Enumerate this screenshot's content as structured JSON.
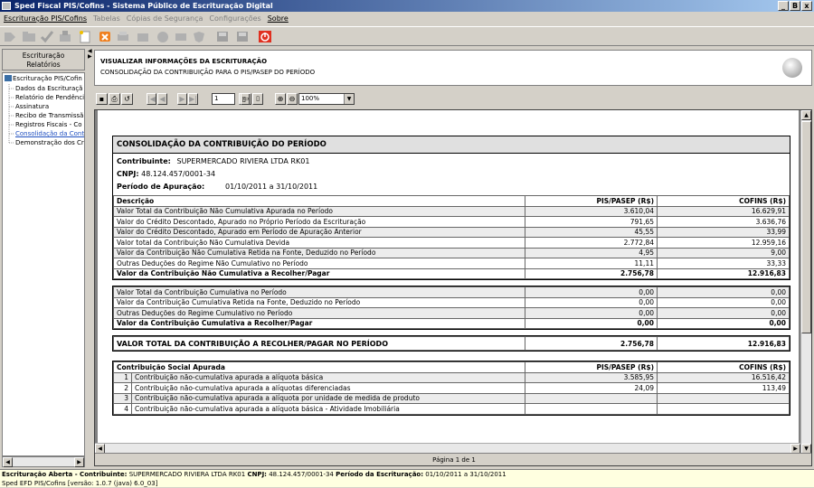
{
  "window": {
    "title": "Sped Fiscal PIS/Cofins - Sistema Público de Escrituração Digital",
    "minimize": "_",
    "maximize": "B",
    "close": "x"
  },
  "menu": [
    "Escrituração PIS/Cofins",
    "Tabelas",
    "Cópias de Segurança",
    "Configurações",
    "Sobre"
  ],
  "nav": {
    "title_line1": "Escrituração",
    "title_line2": "Relatórios",
    "tree": [
      {
        "label": "Escrituração PIS/Cofin",
        "root": true
      },
      {
        "label": "Dados da Escrituraçã"
      },
      {
        "label": "Relatório de Pendência"
      },
      {
        "label": "Assinatura"
      },
      {
        "label": "Recibo de Transmissã"
      },
      {
        "label": "Registros Fiscais - Co"
      },
      {
        "label": "Consolidação da Conti",
        "link": true
      },
      {
        "label": "Demonstração dos Cré"
      }
    ]
  },
  "viewheader": {
    "title": "VISUALIZAR INFORMAÇÕES DA ESCRITURAÇÃO",
    "subtitle": "CONSOLIDAÇÃO DA CONTRIBUIÇÃO PARA O PIS/PASEP DO PERÍODO"
  },
  "reportbar": {
    "page": "1",
    "zoom": "100%"
  },
  "report": {
    "title": "CONSOLIDAÇÃO DA CONTRIBUIÇÃO DO PERÍODO",
    "contrib_label": "Contribuinte:",
    "contrib_value": "SUPERMERCADO RIVIERA LTDA RK01",
    "cnpj_label": "CNPJ:",
    "cnpj_value": "48.124.457/0001-34",
    "periodo_label": "Período de Apuração:",
    "periodo_value": "01/10/2011 a 31/10/2011",
    "col_desc": "Descrição",
    "col_pis": "PIS/PASEP (R$)",
    "col_cofins": "COFINS (R$)",
    "rows1": [
      {
        "d": "Valor Total da Contribuição Não Cumulativa Apurada no Período",
        "p": "3.610,04",
        "c": "16.629,91"
      },
      {
        "d": "Valor do Crédito Descontado, Apurado no Próprio Período da Escrituração",
        "p": "791,65",
        "c": "3.636,76"
      },
      {
        "d": "Valor do Crédito Descontado, Apurado em Período de Apuração Anterior",
        "p": "45,55",
        "c": "33,99"
      },
      {
        "d": "Valor total da Contribuição Não Cumulativa Devida",
        "p": "2.772,84",
        "c": "12.959,16"
      },
      {
        "d": "Valor da Contribuição Não Cumulativa Retida na Fonte, Deduzido no Período",
        "p": "4,95",
        "c": "9,00"
      },
      {
        "d": "Outras Deduções do Regime Não Cumulativo no Período",
        "p": "11,11",
        "c": "33,33"
      },
      {
        "d": "Valor da Contribuição Não Cumulativa a Recolher/Pagar",
        "p": "2.756,78",
        "c": "12.916,83",
        "tot": true
      }
    ],
    "rows2": [
      {
        "d": "Valor Total da Contribuição Cumulativa no Período",
        "p": "0,00",
        "c": "0,00"
      },
      {
        "d": "Valor da Contribuição Cumulativa Retida na Fonte, Deduzido no Período",
        "p": "0,00",
        "c": "0,00"
      },
      {
        "d": "Outras Deduções do Regime Cumulativo no Período",
        "p": "0,00",
        "c": "0,00"
      },
      {
        "d": "Valor da Contribuição Cumulativa a Recolher/Pagar",
        "p": "0,00",
        "c": "0,00",
        "tot": true
      }
    ],
    "grand_label": "VALOR TOTAL DA CONTRIBUIÇÃO A RECOLHER/PAGAR NO PERÍODO",
    "grand_pis": "2.756,78",
    "grand_cofins": "12.916,83",
    "social_label": "Contribuição Social Apurada",
    "rows3": [
      {
        "i": "1",
        "d": "Contribuição não-cumulativa apurada a alíquota básica",
        "p": "3.585,95",
        "c": "16.516,42"
      },
      {
        "i": "2",
        "d": "Contribuição não-cumulativa apurada a alíquotas diferenciadas",
        "p": "24,09",
        "c": "113,49"
      },
      {
        "i": "3",
        "d": "Contribuição não-cumulativa apurada a alíquota por unidade de medida de produto",
        "p": "",
        "c": ""
      },
      {
        "i": "4",
        "d": "Contribuição não-cumulativa apurada a alíquota básica - Atividade Imobiliária",
        "p": "",
        "c": ""
      }
    ]
  },
  "pagestatus": "Página 1 de 1",
  "status": {
    "l1_a": "Escrituração Aberta - Contribuinte:",
    "l1_b": "SUPERMERCADO RIVIERA LTDA RK01",
    "l1_c": "CNPJ:",
    "l1_d": "48.124.457/0001-34",
    "l1_e": "Período da Escrituração:",
    "l1_f": "01/10/2011 a 31/10/2011",
    "l2": "Sped EFD PIS/Cofins [versão: 1.0.7 (java) 6.0_03]"
  }
}
